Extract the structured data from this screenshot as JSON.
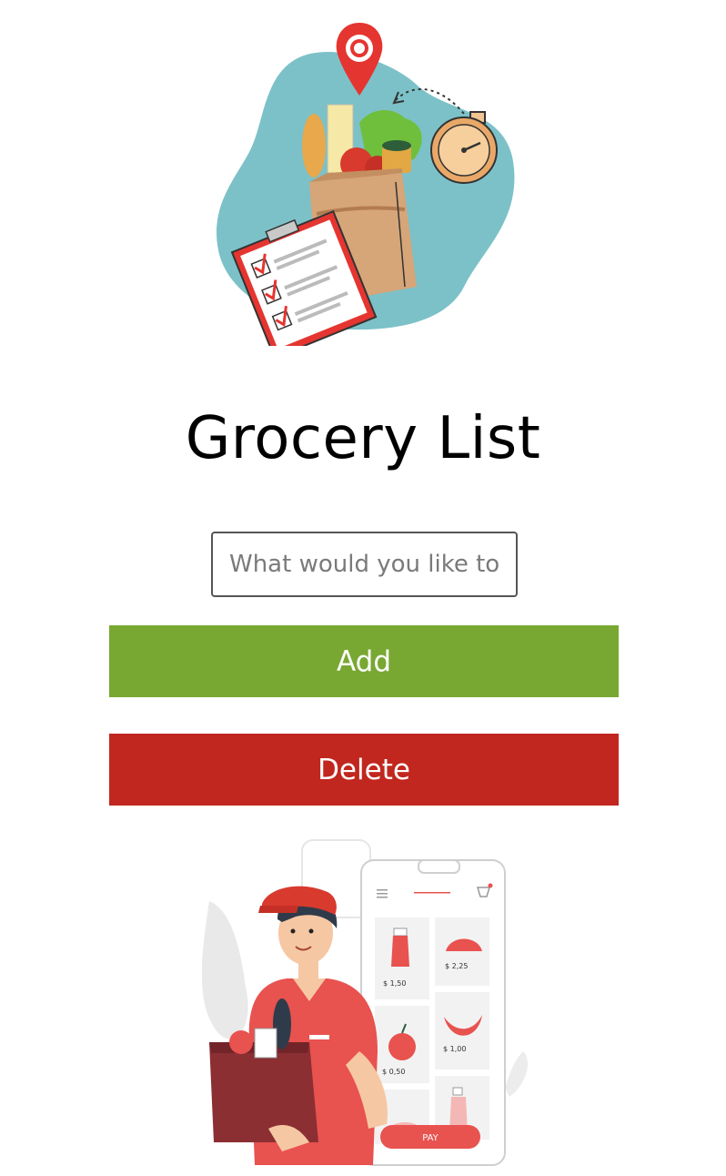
{
  "page": {
    "title": "Grocery List"
  },
  "input": {
    "placeholder": "What would you like to add?",
    "value": ""
  },
  "buttons": {
    "add_label": "Add",
    "delete_label": "Delete"
  },
  "colors": {
    "add": "#78a832",
    "delete": "#c1271e",
    "blob": "#7cc1c8",
    "accent_red": "#e8524f"
  },
  "delivery_app": {
    "prices": [
      "$ 1,50",
      "$ 2,25",
      "$ 0,50",
      "$ 1,00"
    ],
    "pay_label": "PAY"
  }
}
